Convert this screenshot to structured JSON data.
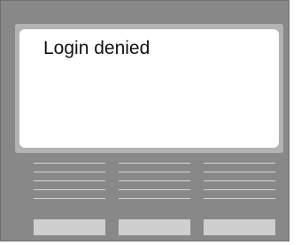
{
  "screen": {
    "message": "Login denied"
  },
  "keypad": {
    "columns": 3,
    "lines_per_column": 5,
    "keys": 3
  },
  "colors": {
    "device_body": "#888888",
    "screen_bezel": "#b3b3b3",
    "screen": "#ffffff",
    "key": "#cfcfcf",
    "line": "#d6d6d6"
  }
}
